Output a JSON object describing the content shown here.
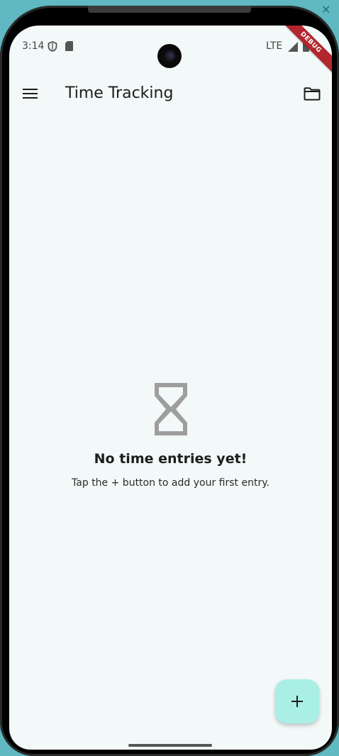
{
  "status_bar": {
    "time": "3:14",
    "network": "LTE",
    "icons": [
      "shield-icon",
      "sd-card-icon",
      "signal-icon",
      "battery-icon"
    ]
  },
  "debug_banner": "DEBUG",
  "app_bar": {
    "title": "Time Tracking",
    "menu_icon": "menu-icon",
    "action_icon": "folder-icon"
  },
  "empty_state": {
    "icon": "hourglass-icon",
    "title": "No time entries yet!",
    "subtitle": "Tap the + button to add your first entry."
  },
  "fab": {
    "icon": "add-icon"
  },
  "colors": {
    "screen_background": "#f2f9f8",
    "fab_background": "#a9efe6",
    "icon_gray": "#9e9e9e",
    "debug_red": "#b3262e"
  }
}
